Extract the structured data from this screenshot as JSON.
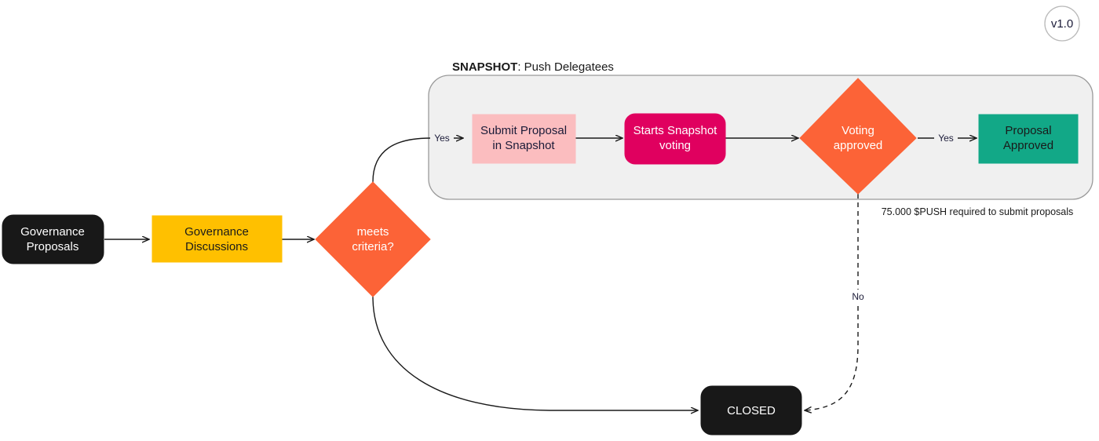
{
  "diagram": {
    "title_bold": "SNAPSHOT",
    "title_rest": ": Push Delegatees",
    "version_badge": "v1.0",
    "note": "75.000 $PUSH required to submit proposals"
  },
  "nodes": {
    "governance_proposals": {
      "label_line1": "Governance",
      "label_line2": "Proposals",
      "fill": "#181818",
      "text": "#ffffff",
      "shape": "rounded-rect"
    },
    "governance_discussions": {
      "label_line1": "Governance",
      "label_line2": "Discussions",
      "fill": "#FFC000",
      "text": "#1a1a1a",
      "shape": "rect"
    },
    "meets_criteria": {
      "label_line1": "meets",
      "label_line2": "criteria?",
      "fill": "#FC6337",
      "text": "#ffffff",
      "shape": "diamond"
    },
    "submit_proposal": {
      "label_line1": "Submit Proposal",
      "label_line2": "in Snapshot",
      "fill": "#FBBDBF",
      "text": "#1b1b38",
      "shape": "rect"
    },
    "starts_voting": {
      "label_line1": "Starts Snapshot",
      "label_line2": "voting",
      "fill": "#E0005F",
      "text": "#ffffff",
      "shape": "rounded-rect"
    },
    "voting_approved": {
      "label_line1": "Voting",
      "label_line2": "approved",
      "fill": "#FC6337",
      "text": "#ffffff",
      "shape": "diamond"
    },
    "proposal_approved": {
      "label_line1": "Proposal",
      "label_line2": "Approved",
      "fill": "#12A887",
      "text": "#1a1a1a",
      "shape": "rect"
    },
    "closed": {
      "label_line1": "CLOSED",
      "label_line2": "",
      "fill": "#181818",
      "text": "#ffffff",
      "shape": "rounded-rect"
    }
  },
  "edges": {
    "criteria_yes": "Yes",
    "voting_yes": "Yes",
    "voting_no": "No"
  },
  "colors": {
    "panel_fill": "#f0f0f0",
    "panel_stroke": "#9a9a9a",
    "edge_stroke": "#1a1a1a",
    "badge_stroke": "#b9b9b9"
  }
}
